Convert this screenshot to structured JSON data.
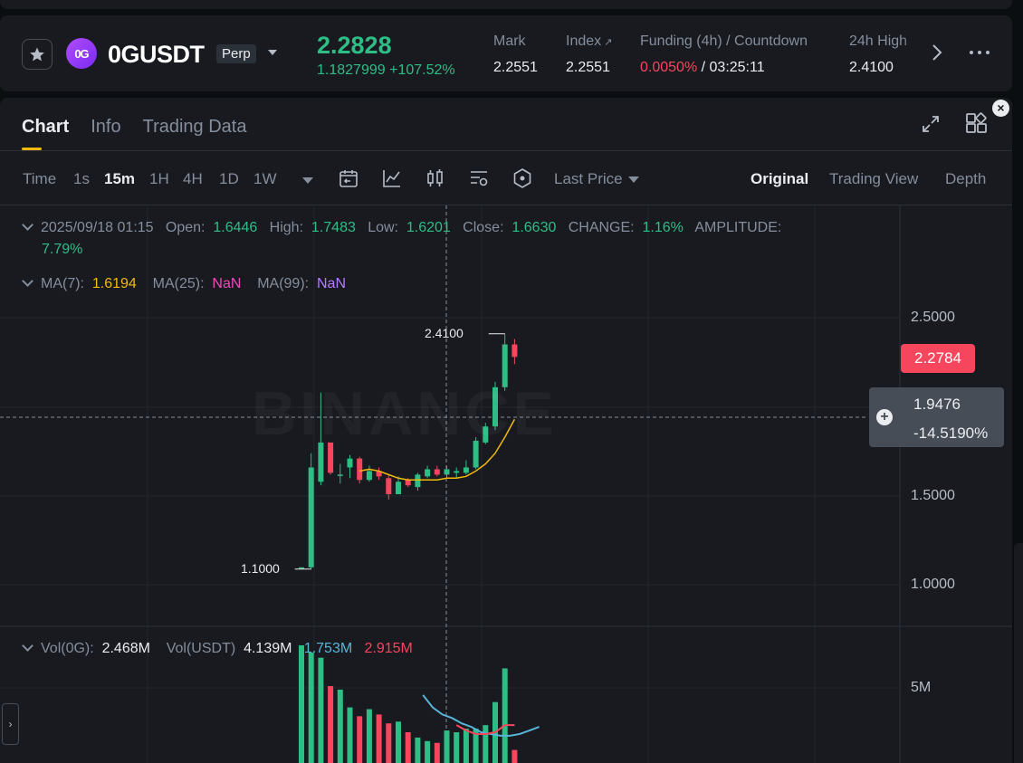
{
  "header": {
    "symbol": "0GUSDT",
    "logo_text": "0G",
    "contract_type": "Perp",
    "last_price": "2.2828",
    "change_abs": "1.1827999",
    "change_pct": "+107.52%",
    "stats": [
      {
        "label": "Mark",
        "value": "2.2551"
      },
      {
        "label": "Index",
        "value": "2.2551"
      },
      {
        "label": "Funding (4h) / Countdown",
        "funding": "0.0050%",
        "countdown": "03:25:11"
      },
      {
        "label": "24h High",
        "value": "2.4100"
      }
    ]
  },
  "tabs": [
    "Chart",
    "Info",
    "Trading Data"
  ],
  "toolbar": {
    "timeframes": [
      "Time",
      "1s",
      "15m",
      "1H",
      "4H",
      "1D",
      "1W"
    ],
    "active_timeframe": "15m",
    "price_type": "Last Price",
    "views": [
      "Original",
      "Trading View",
      "Depth"
    ],
    "active_view": "Original"
  },
  "ohlc_legend": {
    "datetime": "2025/09/18 01:15",
    "open_label": "Open:",
    "open": "1.6446",
    "high_label": "High:",
    "high": "1.7483",
    "low_label": "Low:",
    "low": "1.6201",
    "close_label": "Close:",
    "close": "1.6630",
    "change_label": "CHANGE:",
    "change": "1.16%",
    "amplitude_label": "AMPLITUDE:",
    "amplitude": "7.79%"
  },
  "ma_legend": {
    "ma7_label": "MA(7):",
    "ma7": "1.6194",
    "ma25_label": "MA(25):",
    "ma25": "NaN",
    "ma99_label": "MA(99):",
    "ma99": "NaN"
  },
  "vol_legend": {
    "vol_label": "Vol(0G):",
    "vol": "2.468M",
    "vol_usdt_label": "Vol(USDT)",
    "vol_usdt": "4.139M",
    "ma_a": "1.753M",
    "ma_b": "2.915M"
  },
  "price_axis": [
    "2.5000",
    "1.5000",
    "1.0000"
  ],
  "volume_axis": [
    "5M"
  ],
  "current_price_tag": "2.2784",
  "crosshair": {
    "price": "1.9476",
    "pct": "-14.5190%"
  },
  "high_marker": "2.4100",
  "low_marker": "1.1000",
  "watermark": "BINANCE",
  "colors": {
    "up": "#2ebd85",
    "down": "#f6465d",
    "accent": "#f0b90b",
    "ma7": "#f0b90b",
    "vol_ma1": "#58b5d8",
    "vol_ma2": "#f6465d"
  },
  "candles": [
    {
      "o": 1.1,
      "h": 1.1,
      "l": 1.1,
      "c": 1.1
    },
    {
      "o": 1.1,
      "h": 1.74,
      "l": 1.09,
      "c": 1.66
    },
    {
      "o": 1.58,
      "h": 2.08,
      "l": 1.56,
      "c": 1.8
    },
    {
      "o": 1.8,
      "h": 1.8,
      "l": 1.62,
      "c": 1.63
    },
    {
      "o": 1.62,
      "h": 1.68,
      "l": 1.57,
      "c": 1.62
    },
    {
      "o": 1.66,
      "h": 1.73,
      "l": 1.6,
      "c": 1.71
    },
    {
      "o": 1.71,
      "h": 1.72,
      "l": 1.57,
      "c": 1.59
    },
    {
      "o": 1.59,
      "h": 1.67,
      "l": 1.58,
      "c": 1.64
    },
    {
      "o": 1.64,
      "h": 1.66,
      "l": 1.59,
      "c": 1.61
    },
    {
      "o": 1.6,
      "h": 1.62,
      "l": 1.48,
      "c": 1.51
    },
    {
      "o": 1.51,
      "h": 1.61,
      "l": 1.51,
      "c": 1.58
    },
    {
      "o": 1.59,
      "h": 1.6,
      "l": 1.55,
      "c": 1.56
    },
    {
      "o": 1.55,
      "h": 1.63,
      "l": 1.53,
      "c": 1.62
    },
    {
      "o": 1.61,
      "h": 1.67,
      "l": 1.6,
      "c": 1.65
    },
    {
      "o": 1.65,
      "h": 1.67,
      "l": 1.61,
      "c": 1.62
    },
    {
      "o": 1.62,
      "h": 1.67,
      "l": 1.6,
      "c": 1.65
    },
    {
      "o": 1.63,
      "h": 1.66,
      "l": 1.6,
      "c": 1.64
    },
    {
      "o": 1.63,
      "h": 1.7,
      "l": 1.62,
      "c": 1.66
    },
    {
      "o": 1.66,
      "h": 1.83,
      "l": 1.65,
      "c": 1.81
    },
    {
      "o": 1.8,
      "h": 1.91,
      "l": 1.79,
      "c": 1.89
    },
    {
      "o": 1.89,
      "h": 2.14,
      "l": 1.87,
      "c": 2.11
    },
    {
      "o": 2.11,
      "h": 2.41,
      "l": 2.09,
      "c": 2.35
    },
    {
      "o": 2.35,
      "h": 2.38,
      "l": 2.24,
      "c": 2.28
    }
  ],
  "ma7_line": [
    null,
    null,
    null,
    null,
    null,
    null,
    1.64,
    1.65,
    1.64,
    1.62,
    1.6,
    1.59,
    1.59,
    1.59,
    1.59,
    1.6,
    1.6,
    1.61,
    1.64,
    1.68,
    1.74,
    1.83,
    1.93
  ],
  "volumes": [
    7.4,
    7.0,
    6.7,
    5.1,
    4.9,
    3.9,
    3.4,
    3.8,
    3.5,
    3.0,
    3.1,
    2.5,
    2.2,
    2.0,
    1.9,
    2.6,
    2.5,
    2.7,
    2.7,
    2.9,
    4.2,
    6.1,
    1.5
  ],
  "vol_ma1": [
    null,
    null,
    null,
    null,
    null,
    null,
    4.6,
    3.9,
    3.5,
    3.3,
    3.0,
    2.8,
    2.5,
    2.4,
    2.3,
    2.3,
    2.4,
    2.6,
    2.8
  ],
  "vol_ma2": [
    null,
    null,
    null,
    null,
    null,
    null,
    null,
    null,
    null,
    null,
    null,
    null,
    null,
    null,
    null,
    null,
    2.9,
    2.6,
    2.4,
    2.4,
    2.5,
    2.9,
    2.9
  ]
}
